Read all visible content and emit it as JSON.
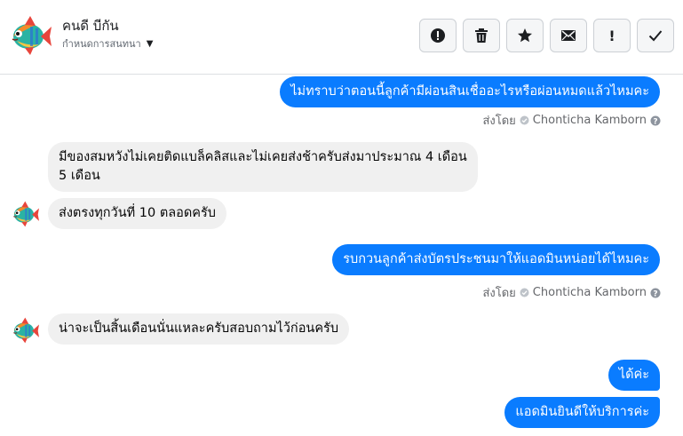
{
  "header": {
    "contact_name": "คนดี บีกัน",
    "assign_label": "กำหนดการสนทนา",
    "actions": [
      {
        "name": "spam-button",
        "icon": "alert-circle-icon"
      },
      {
        "name": "delete-button",
        "icon": "trash-icon"
      },
      {
        "name": "star-button",
        "icon": "star-icon"
      },
      {
        "name": "mark-unread-button",
        "icon": "envelope-icon"
      },
      {
        "name": "follow-up-button",
        "icon": "exclamation-icon",
        "text": "!"
      },
      {
        "name": "done-button",
        "icon": "check-icon"
      }
    ]
  },
  "messages": [
    {
      "side": "out",
      "text": "ไม่ทราบว่าตอนนี้ลูกค้ามีผ่อนสินเชื่ออะไรหรือผ่อนหมดแล้วไหมคะ"
    },
    {
      "sent_by_label": "ส่งโดย",
      "agent": "Chonticha Kamborn"
    },
    {
      "side": "in",
      "line1": "มีของสมหวังไม่เคยติดแบล็คลิสและไม่เคยส่งช้าครับส่งมาประมาณ 4 เดือน",
      "line2": "5 เดือน"
    },
    {
      "side": "in",
      "text": "ส่งตรงทุกวันที่ 10 ตลอดครับ"
    },
    {
      "side": "out",
      "text": "รบกวนลูกค้าส่งบัตรประชนมาให้แอดมินหน่อยได้ไหมคะ"
    },
    {
      "sent_by_label": "ส่งโดย",
      "agent": "Chonticha Kamborn"
    },
    {
      "side": "in",
      "text": "น่าจะเป็นสิ้นเดือนนั่นแหละครับสอบถามไว้ก่อนครับ"
    },
    {
      "side": "out",
      "text": "ได้ค่ะ"
    },
    {
      "side": "out",
      "text": "แอดมินยินดีให้บริการค่ะ"
    }
  ],
  "colors": {
    "outgoing_bubble": "#0a7cff",
    "incoming_bubble": "#f0f0f0",
    "meta_text": "#65676b"
  }
}
